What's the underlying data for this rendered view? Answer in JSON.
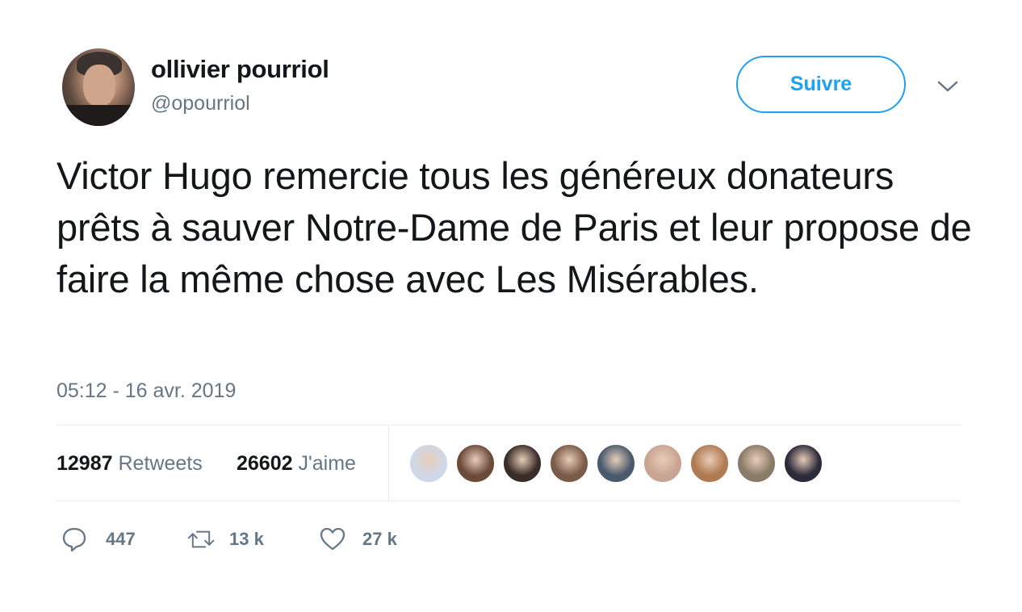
{
  "author": {
    "name": "ollivier pourriol",
    "handle": "@opourriol"
  },
  "follow_label": "Suivre",
  "tweet": {
    "text": "Victor Hugo remercie tous les généreux donateurs prêts à sauver Notre-Dame de Paris et leur propose de faire la même chose avec Les Misérables.",
    "timestamp": "05:12 - 16 avr. 2019"
  },
  "stats": {
    "retweets_count": "12987",
    "retweets_label": "Retweets",
    "likes_count": "26602",
    "likes_label": "J'aime"
  },
  "likers": [
    {
      "name": "liker-avatar-1",
      "color": "#cfd8e8"
    },
    {
      "name": "liker-avatar-2",
      "color": "#6b4a3a"
    },
    {
      "name": "liker-avatar-3",
      "color": "#3a2c28"
    },
    {
      "name": "liker-avatar-4",
      "color": "#7a5a48"
    },
    {
      "name": "liker-avatar-5",
      "color": "#4a5a6e"
    },
    {
      "name": "liker-avatar-6",
      "color": "#c9a493"
    },
    {
      "name": "liker-avatar-7",
      "color": "#b07a52"
    },
    {
      "name": "liker-avatar-8",
      "color": "#8a7a68"
    },
    {
      "name": "liker-avatar-9",
      "color": "#2d2a3a"
    }
  ],
  "actions": {
    "replies": "447",
    "retweets": "13 k",
    "likes": "27 k"
  },
  "colors": {
    "accent": "#1da1f2",
    "secondary_text": "#657786",
    "primary_text": "#14171a",
    "divider": "#e6ecf0"
  },
  "icons": {
    "reply": "speech-bubble-icon",
    "retweet": "retweet-arrows-icon",
    "like": "heart-icon",
    "menu": "chevron-down-icon"
  }
}
